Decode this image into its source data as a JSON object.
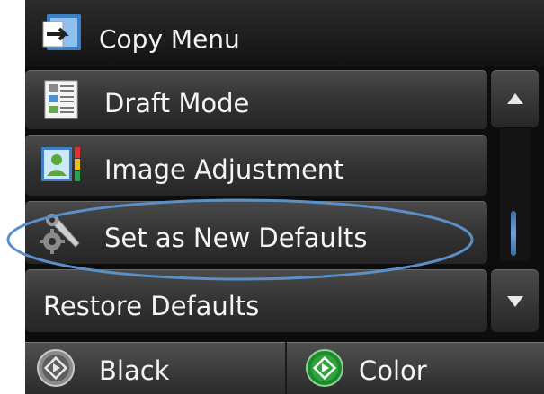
{
  "title": "Copy Menu",
  "menu_items": [
    {
      "label": "Draft Mode",
      "icon": "draft-document-icon"
    },
    {
      "label": "Image Adjustment",
      "icon": "image-adjustment-icon"
    },
    {
      "label": "Set as New Defaults",
      "icon": "tools-icon",
      "highlighted": true
    },
    {
      "label": "Restore Defaults"
    }
  ],
  "buttons": {
    "black": {
      "label": "Black",
      "icon": "start-icon"
    },
    "color": {
      "label": "Color",
      "icon": "start-icon",
      "accent": "#2fa43a"
    }
  },
  "colors": {
    "highlight": "#5a8fc8"
  }
}
